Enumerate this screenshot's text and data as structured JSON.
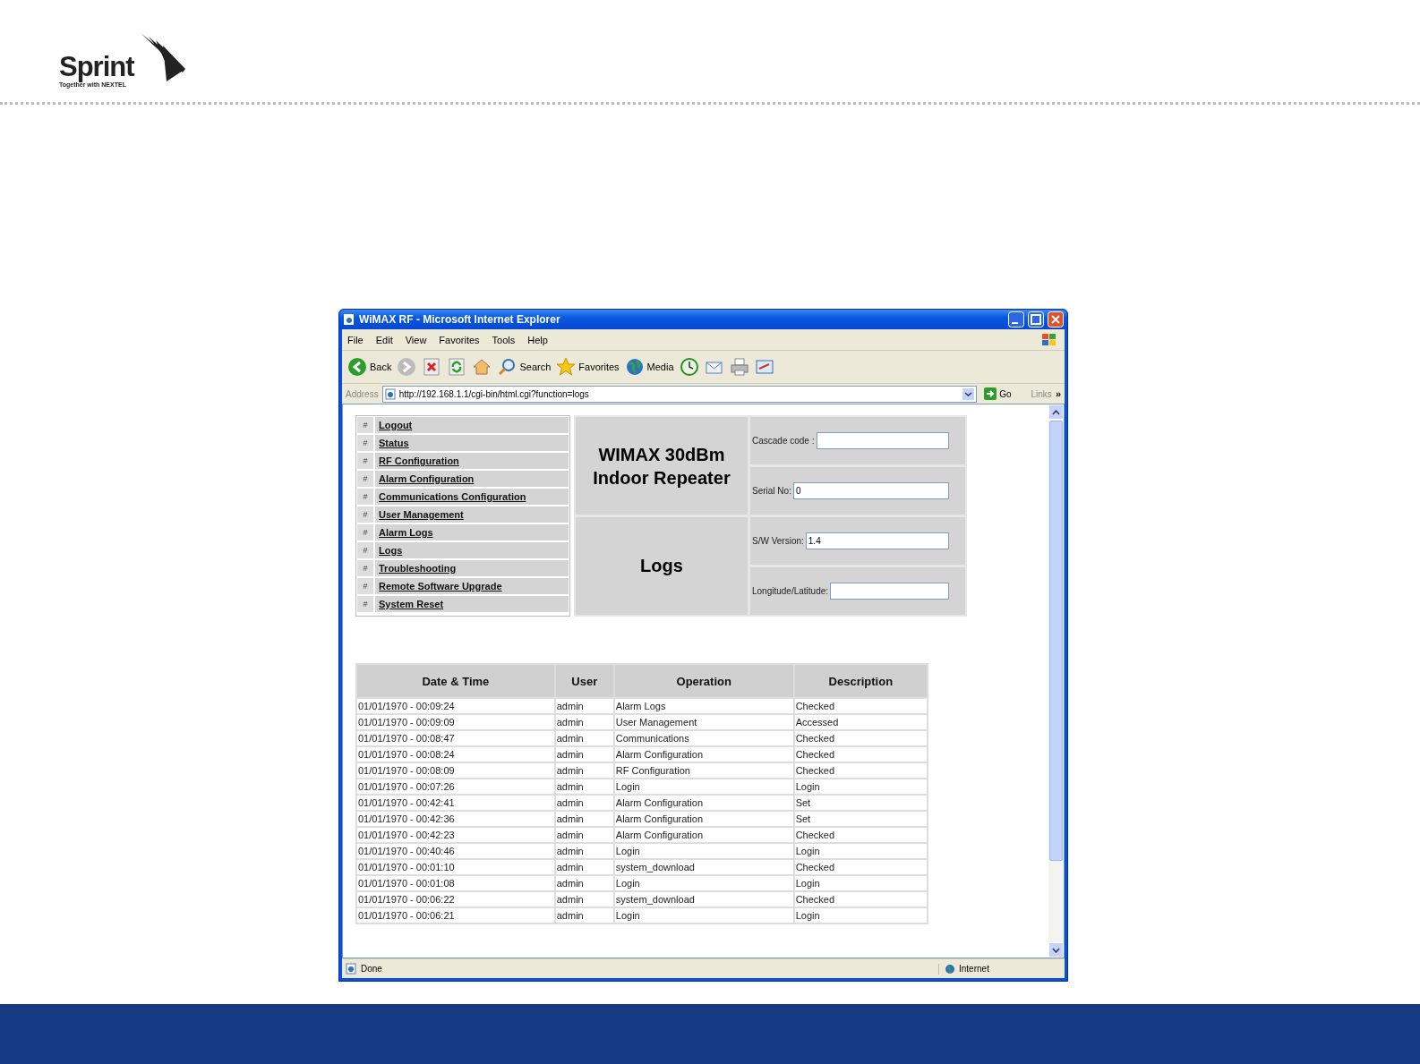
{
  "slide": {
    "logo": {
      "wordmark": "Sprint",
      "tagline": "Together with NEXTEL"
    }
  },
  "window": {
    "title": "WiMAX RF - Microsoft Internet Explorer",
    "menu": [
      "File",
      "Edit",
      "View",
      "Favorites",
      "Tools",
      "Help"
    ],
    "toolbar": [
      {
        "kind": "back",
        "label": "Back"
      },
      {
        "kind": "forward"
      },
      {
        "kind": "stop"
      },
      {
        "kind": "refresh"
      },
      {
        "kind": "home"
      },
      {
        "kind": "search",
        "label": "Search"
      },
      {
        "kind": "favorites",
        "label": "Favorites"
      },
      {
        "kind": "media",
        "label": "Media"
      },
      {
        "kind": "history"
      },
      {
        "kind": "mail"
      },
      {
        "kind": "print"
      },
      {
        "kind": "edit"
      }
    ],
    "address": {
      "label": "Address",
      "value": "http://192.168.1.1/cgi-bin/html.cgi?function=logs",
      "go": "Go",
      "links": "Links",
      "more": "»"
    },
    "status_bar": {
      "text": "Done",
      "zone": "Internet"
    }
  },
  "page": {
    "nav": [
      {
        "marker": "#",
        "label": "Logout"
      },
      {
        "marker": "#",
        "label": "Status"
      },
      {
        "marker": "#",
        "label": "RF Configuration"
      },
      {
        "marker": "#",
        "label": "Alarm Configuration"
      },
      {
        "marker": "#",
        "label": "Communications Configuration"
      },
      {
        "marker": "#",
        "label": "User Management"
      },
      {
        "marker": "#",
        "label": "Alarm Logs"
      },
      {
        "marker": "#",
        "label": "Logs"
      },
      {
        "marker": "#",
        "label": "Troubleshooting"
      },
      {
        "marker": "#",
        "label": "Remote Software Upgrade"
      },
      {
        "marker": "#",
        "label": "System Reset"
      }
    ],
    "device_title": "WIMAX 30dBm Indoor Repeater",
    "section_title": "Logs",
    "fields": [
      {
        "label": "Cascade code :"
      },
      {
        "label": "Serial No:",
        "value": "0"
      },
      {
        "label": "S/W Version:",
        "value": "1.4"
      },
      {
        "label": "Longitude/Latitude:"
      }
    ],
    "table": {
      "columns": [
        "Date & Time",
        "User",
        "Operation",
        "Description"
      ],
      "rows": [
        [
          "01/01/1970 - 00:09:24",
          "admin",
          "Alarm Logs",
          "Checked"
        ],
        [
          "01/01/1970 - 00:09:09",
          "admin",
          "User Management",
          "Accessed"
        ],
        [
          "01/01/1970 - 00:08:47",
          "admin",
          "Communications",
          "Checked"
        ],
        [
          "01/01/1970 - 00:08:24",
          "admin",
          "Alarm Configuration",
          "Checked"
        ],
        [
          "01/01/1970 - 00:08:09",
          "admin",
          "RF Configuration",
          "Checked"
        ],
        [
          "01/01/1970 - 00:07:26",
          "admin",
          "Login",
          "Login"
        ],
        [
          "01/01/1970 - 00:42:41",
          "admin",
          "Alarm Configuration",
          "Set"
        ],
        [
          "01/01/1970 - 00:42:36",
          "admin",
          "Alarm Configuration",
          "Set"
        ],
        [
          "01/01/1970 - 00:42:23",
          "admin",
          "Alarm Configuration",
          "Checked"
        ],
        [
          "01/01/1970 - 00:40:46",
          "admin",
          "Login",
          "Login"
        ],
        [
          "01/01/1970 - 00:01:10",
          "admin",
          "system_download",
          "Checked"
        ],
        [
          "01/01/1970 - 00:01:08",
          "admin",
          "Login",
          "Login"
        ],
        [
          "01/01/1970 - 00:06:22",
          "admin",
          "system_download",
          "Checked"
        ],
        [
          "01/01/1970 - 00:06:21",
          "admin",
          "Login",
          "Login"
        ]
      ]
    }
  }
}
